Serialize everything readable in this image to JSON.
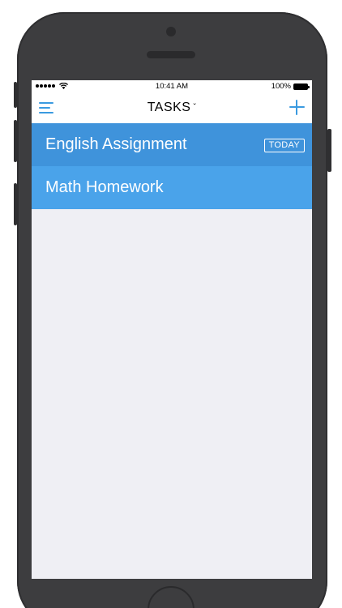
{
  "status_bar": {
    "time": "10:41 AM",
    "battery": "100%",
    "icons": [
      "signal-icon",
      "wifi-icon",
      "battery-icon"
    ]
  },
  "nav": {
    "title": "TASKS",
    "menu_icon": "hamburger-menu-icon",
    "add_icon": "plus-icon",
    "accent_color": "#3a9ae0"
  },
  "tasks": [
    {
      "title": "English Assignment",
      "badge": "TODAY",
      "color": "#3f93db"
    },
    {
      "title": "Math Homework",
      "badge": "",
      "color": "#4aa3ea"
    }
  ],
  "colors": {
    "screen_background": "#efeff4",
    "phone_body": "#3d3d3f"
  }
}
